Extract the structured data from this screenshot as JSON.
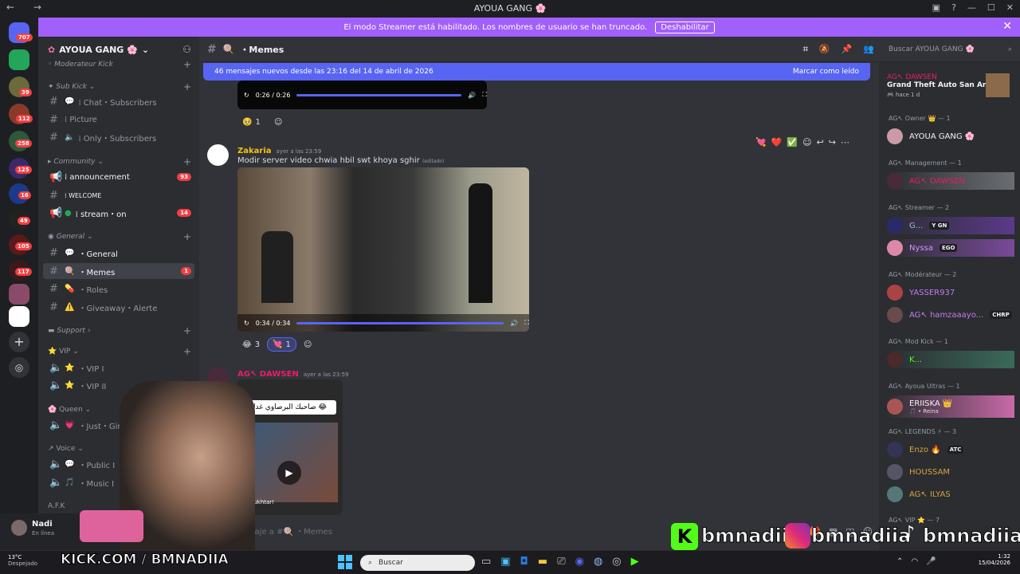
{
  "window": {
    "title": "AYOUA GANG 🌸"
  },
  "banner": {
    "text": "El modo Streamer está habilitado. Los nombres de usuario se han truncado.",
    "button": "Deshabilitar"
  },
  "server_badges": [
    "707",
    "39",
    "112",
    "258",
    "125",
    "16",
    "49",
    "105",
    "117"
  ],
  "guild": {
    "name": "AYOUA GANG 🌸"
  },
  "channels": {
    "cat_moderateur": "Moderateur Kick",
    "cat_subkick": "Sub Kick",
    "chat": "⁞ Chat・Subscribers",
    "picture": "⁞ Picture",
    "only": "⁞ Only・Subscribers",
    "cat_community": "Community",
    "announcement": "⁞ announcement",
    "announcement_count": "93",
    "welcome": "⁞ WELCOME",
    "stream": "⁞ stream・on",
    "stream_count": "14",
    "cat_general": "General",
    "general": "・General",
    "memes": "・Memes",
    "memes_count": "1",
    "roles": "・Roles",
    "giveaway": "・Giveaway・Alerte",
    "cat_support": "Support",
    "cat_vip": "VIP",
    "vip1": "・VIP Ⅰ",
    "vip2": "・VIP ⅠⅠ",
    "cat_queen": "Queen",
    "justgirl": "・Just・Girl Ⅰ",
    "cat_voice": "Voice",
    "public": "・Public Ⅰ",
    "music": "・Music Ⅰ",
    "cat_afk": "A.F.K"
  },
  "user": {
    "name": "Nadi",
    "status": "En línea"
  },
  "header": {
    "channel": "・Memes",
    "search": "Buscar AYOUA GANG 🌸"
  },
  "newbar": {
    "text": "46 mensajes nuevos desde las 23:16 del 14 de abril de 2026",
    "mark": "Marcar como leído"
  },
  "messages": {
    "video1_time": "0:26 / 0:26",
    "video1_react": "1",
    "m2_author": "Zakaria",
    "m2_time": "ayer a las 23:59",
    "m2_text": "Modir server video chwia hbil swt khoya sghir",
    "m2_edited": "(editado)",
    "video2_time": "0:34 / 0:34",
    "m2_react1": "3",
    "m2_react2": "1",
    "m3_author": "AG↖ DAWSEN",
    "m3_time": "ayer a las 23:59",
    "m3_caption": "صاحبك البرصاوي غدا 😂",
    "m3_sub": "Moukhtar!",
    "composer": "...aje a #🍭 ・Memes"
  },
  "members": {
    "activity_name": "AG↖ DAWSEN",
    "activity_game": "Grand Theft Auto San Andr...",
    "activity_time": "hace 1 d",
    "groups": [
      {
        "label": "AG↖ Owner 👑 — 1"
      },
      {
        "label": "AG↖ Management — 1"
      },
      {
        "label": "AG↖ Streamer — 2"
      },
      {
        "label": "AG↖ Modérateur — 2"
      },
      {
        "label": "AG↖ Mod Kick — 1"
      },
      {
        "label": "AG↖ Ayoua Ultras — 1"
      },
      {
        "label": "AG↖ LEGENDS ⚡ — 3"
      },
      {
        "label": "AG↖ VIP ⭐ — 7"
      }
    ],
    "names": {
      "owner": "AYOUA GANG 🌸",
      "mgmt": "AG↖ DAWSEN",
      "streamer1": "G...",
      "streamer1_tag": "Y GN",
      "streamer2": "Nyssa",
      "streamer2_tag": "EGO",
      "mod1": "YASSER937",
      "mod2": "AG↖ hamzaaayo...",
      "mod2_tag": "CHRP",
      "modkick": "K...",
      "ultras": "ERIISKA 👑",
      "ultras_sub": "🎵 • Reina",
      "legend1": "Enzo 🔥",
      "legend1_tag": "ATC",
      "legend2": "HOUSSAM",
      "legend3": "AG↖ ILYAS"
    }
  },
  "overlay": {
    "kick_url": "KICK.COM / BMNADIIA",
    "handle": "bmnadiia"
  },
  "taskbar": {
    "weather_temp": "13°C",
    "weather_text": "Despejado",
    "search": "Buscar",
    "time": "1:32",
    "date": "15/04/2026"
  },
  "colors": {
    "accent": "#5865f2",
    "banner": "#a15ffb",
    "zakaria": "#f1c40f",
    "dawsen": "#e91e63"
  }
}
